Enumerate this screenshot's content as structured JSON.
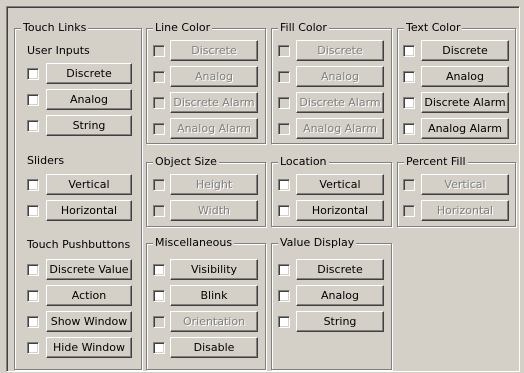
{
  "touch_links": {
    "title": "Touch Links",
    "user_inputs": {
      "heading": "User Inputs",
      "buttons": [
        "Discrete",
        "Analog",
        "String"
      ]
    },
    "sliders": {
      "heading": "Sliders",
      "buttons": [
        "Vertical",
        "Horizontal"
      ]
    },
    "pushbuttons": {
      "heading": "Touch Pushbuttons",
      "buttons": [
        "Discrete Value",
        "Action",
        "Show Window",
        "Hide Window"
      ]
    }
  },
  "line_color": {
    "title": "Line Color",
    "buttons": [
      "Discrete",
      "Analog",
      "Discrete Alarm",
      "Analog Alarm"
    ]
  },
  "fill_color": {
    "title": "Fill Color",
    "buttons": [
      "Discrete",
      "Analog",
      "Discrete Alarm",
      "Analog Alarm"
    ]
  },
  "text_color": {
    "title": "Text Color",
    "buttons": [
      "Discrete",
      "Analog",
      "Discrete Alarm",
      "Analog Alarm"
    ]
  },
  "object_size": {
    "title": "Object Size",
    "buttons": [
      "Height",
      "Width"
    ]
  },
  "location": {
    "title": "Location",
    "buttons": [
      "Vertical",
      "Horizontal"
    ]
  },
  "percent_fill": {
    "title": "Percent Fill",
    "buttons": [
      "Vertical",
      "Horizontal"
    ]
  },
  "miscellaneous": {
    "title": "Miscellaneous",
    "buttons": [
      "Visibility",
      "Blink",
      "Orientation",
      "Disable"
    ]
  },
  "value_display": {
    "title": "Value Display",
    "buttons": [
      "Discrete",
      "Analog",
      "String"
    ]
  }
}
